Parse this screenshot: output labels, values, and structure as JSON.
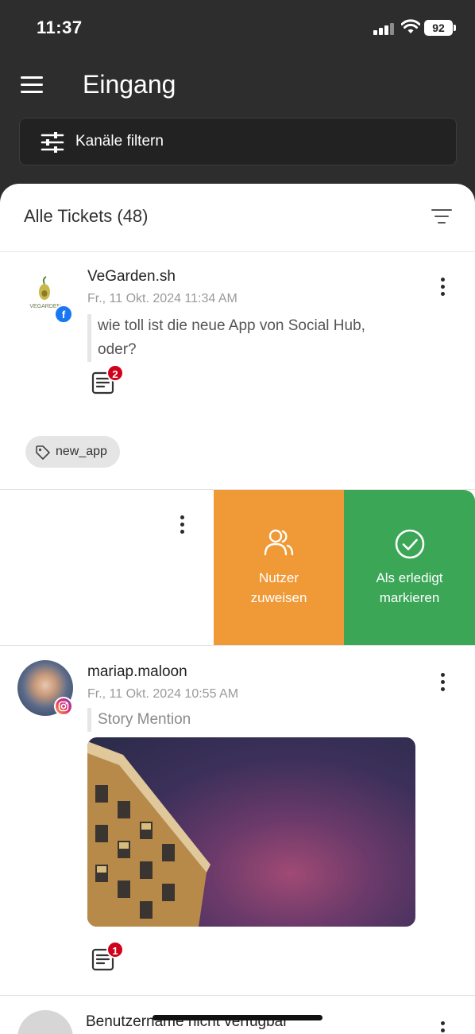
{
  "status_bar": {
    "time": "11:37",
    "battery": "92"
  },
  "header": {
    "title": "Eingang",
    "filter_label": "Kanäle filtern"
  },
  "list": {
    "title": "Alle Tickets (48)"
  },
  "tickets": [
    {
      "author": "VeGarden.sh",
      "date": "Fr., 11 Okt. 2024 11:34 AM",
      "message_line1": "wie toll ist die neue App von Social Hub,",
      "message_line2": "oder?",
      "channel": "facebook",
      "note_count": "2",
      "tag": "new_app",
      "avatar_logo_text": "VEGARDEN"
    },
    {
      "author": "mariap.maloon",
      "date": "Fr., 11 Okt. 2024 10:55 AM",
      "message_line1": "Story Mention",
      "channel": "instagram",
      "note_count": "1"
    },
    {
      "author": "Benutzername nicht verfügbar"
    }
  ],
  "swipe_actions": {
    "assign_line1": "Nutzer",
    "assign_line2": "zuweisen",
    "done_line1": "Als erledigt",
    "done_line2": "markieren"
  },
  "colors": {
    "assign": "#f09a37",
    "done": "#3aa656",
    "badge": "#d0021b",
    "facebook": "#1877f2"
  }
}
